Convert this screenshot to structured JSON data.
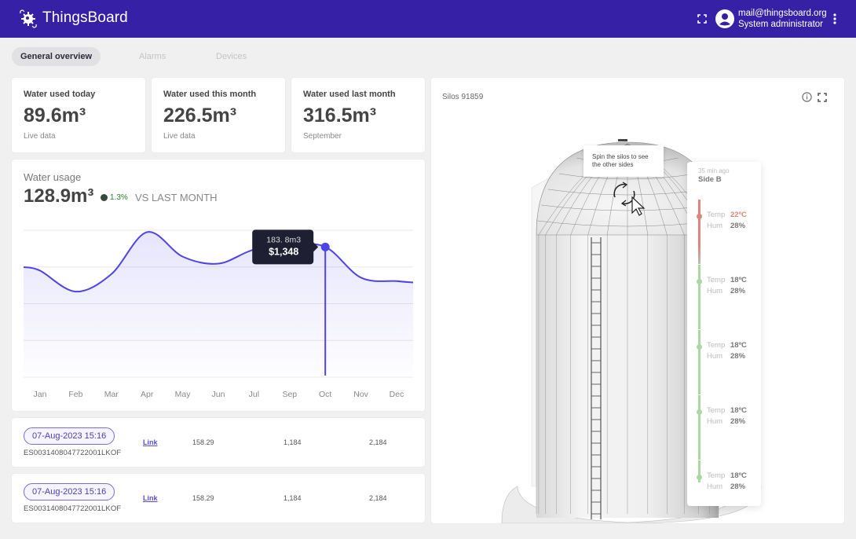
{
  "header": {
    "brand": "ThingsBoard",
    "user_email": "mail@thingsboard.org",
    "user_role": "System administrator",
    "color": "#3621a6"
  },
  "tabs": [
    {
      "label": "General overview",
      "active": true
    },
    {
      "label": "Alarms",
      "active": false
    },
    {
      "label": "Devices",
      "active": false
    }
  ],
  "kpis": [
    {
      "title": "Water used today",
      "value": "89.6m³",
      "sub": "Live data"
    },
    {
      "title": "Water used this month",
      "value": "226.5m³",
      "sub": "Live data"
    },
    {
      "title": "Water used last month",
      "value": "316.5m³",
      "sub": "September"
    }
  ],
  "water_usage": {
    "title": "Water usage",
    "value": "128.9m³",
    "change": "1.3%",
    "vs_label": "VS LAST MONTH",
    "tooltip": {
      "volume": "183. 8m3",
      "cost": "$1,348"
    }
  },
  "chart_data": {
    "type": "area",
    "title": "Water usage",
    "categories": [
      "Jan",
      "Feb",
      "Mar",
      "Apr",
      "May",
      "Jun",
      "Jul",
      "Sep",
      "Oct",
      "Nov",
      "Dec"
    ],
    "series": [
      {
        "name": "Water usage",
        "values": [
          150,
          120,
          145,
          205,
          170,
          160,
          180,
          185,
          184,
          140,
          135
        ]
      }
    ],
    "highlight": {
      "category": "Oct",
      "value": 183.8,
      "label": "183. 8m3",
      "cost": "$1,348"
    },
    "ylim": [
      0,
      210
    ],
    "grid": true,
    "line_color": "#5043e6",
    "xlabel": "",
    "ylabel": ""
  },
  "rows": [
    {
      "date": "07-Aug-2023 15:16",
      "id": "ES0031408047722001LKOF",
      "link": "Link",
      "v1": "158.29",
      "v2": "1,184",
      "v3": "2,184"
    },
    {
      "date": "07-Aug-2023 15:16",
      "id": "ES0031408047722001LKOF",
      "link": "Link",
      "v1": "158.29",
      "v2": "1,184",
      "v3": "2,184"
    }
  ],
  "silo": {
    "title": "Silos 91859",
    "hint": "Spin the silos to see the other sides",
    "panel": {
      "ago": "35 min ago",
      "side": "Side B",
      "sensors": [
        {
          "temp_label": "Temp",
          "temp": "22ºC",
          "hum_label": "Hum",
          "hum": "28%",
          "status": "hot"
        },
        {
          "temp_label": "Temp",
          "temp": "18ºC",
          "hum_label": "Hum",
          "hum": "28%",
          "status": "ok"
        },
        {
          "temp_label": "Temp",
          "temp": "18ºC",
          "hum_label": "Hum",
          "hum": "28%",
          "status": "ok"
        },
        {
          "temp_label": "Temp",
          "temp": "18ºC",
          "hum_label": "Hum",
          "hum": "28%",
          "status": "ok"
        },
        {
          "temp_label": "Temp",
          "temp": "18ºC",
          "hum_label": "Hum",
          "hum": "28%",
          "status": "ok"
        }
      ],
      "hot_color": "#e0857a",
      "ok_color": "#a9d8a4"
    }
  }
}
